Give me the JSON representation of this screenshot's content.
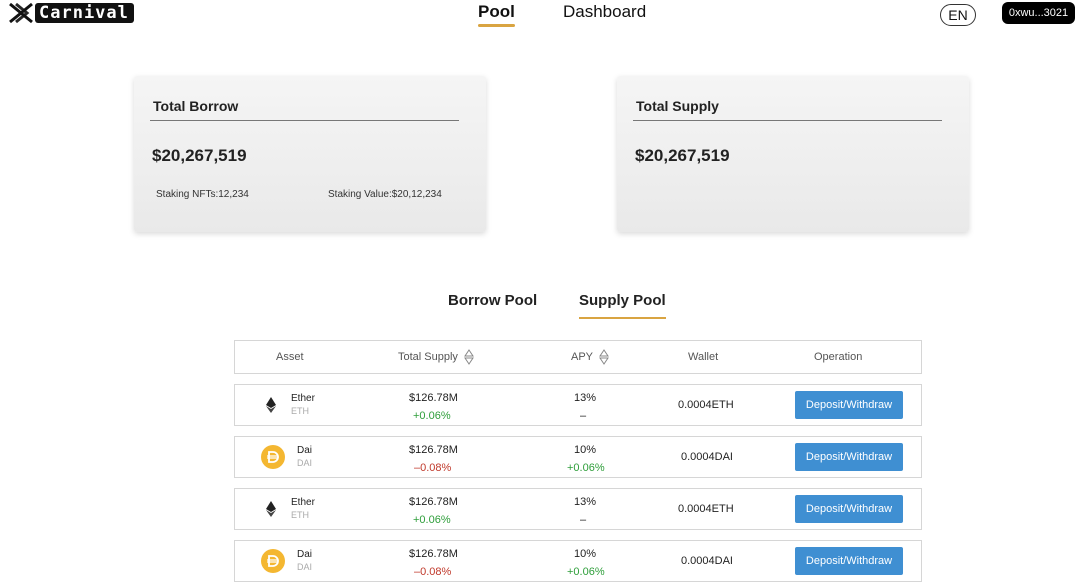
{
  "header": {
    "logo_text": "Carnival",
    "nav": [
      {
        "label": "Pool",
        "active": true
      },
      {
        "label": "Dashboard",
        "active": false
      }
    ],
    "language": "EN",
    "wallet_address": "0xwu...3021"
  },
  "stats": {
    "borrow": {
      "title": "Total Borrow",
      "value": "$20,267,519",
      "staking_nfts": "Staking NFTs:12,234",
      "staking_value": "Staking Value:$20,12,234"
    },
    "supply": {
      "title": "Total Supply",
      "value": "$20,267,519"
    }
  },
  "pool_tabs": [
    {
      "label": "Borrow Pool",
      "active": false
    },
    {
      "label": "Supply Pool",
      "active": true
    }
  ],
  "table": {
    "headers": {
      "asset": "Asset",
      "total_supply": "Total Supply",
      "apy": "APY",
      "wallet": "Wallet",
      "operation": "Operation"
    },
    "rows": [
      {
        "icon": "eth",
        "name": "Ether",
        "symbol": "ETH",
        "total_supply": "$126.78M",
        "supply_change": "+0.06%",
        "apy": "13%",
        "apy_change": "–",
        "wallet": "0.0004ETH",
        "button": "Deposit/Withdraw"
      },
      {
        "icon": "dai",
        "name": "Dai",
        "symbol": "DAI",
        "total_supply": "$126.78M",
        "supply_change": "–0.08%",
        "apy": "10%",
        "apy_change": "+0.06%",
        "wallet": "0.0004DAI",
        "button": "Deposit/Withdraw"
      },
      {
        "icon": "eth",
        "name": "Ether",
        "symbol": "ETH",
        "total_supply": "$126.78M",
        "supply_change": "+0.06%",
        "apy": "13%",
        "apy_change": "–",
        "wallet": "0.0004ETH",
        "button": "Deposit/Withdraw"
      },
      {
        "icon": "dai",
        "name": "Dai",
        "symbol": "DAI",
        "total_supply": "$126.78M",
        "supply_change": "–0.08%",
        "apy": "10%",
        "apy_change": "+0.06%",
        "wallet": "0.0004DAI",
        "button": "Deposit/Withdraw"
      }
    ]
  },
  "colors": {
    "accent": "#d9a441",
    "button": "#3f8fd2",
    "positive": "#2e9e3a",
    "negative": "#c0392b",
    "dai": "#f4b731"
  }
}
